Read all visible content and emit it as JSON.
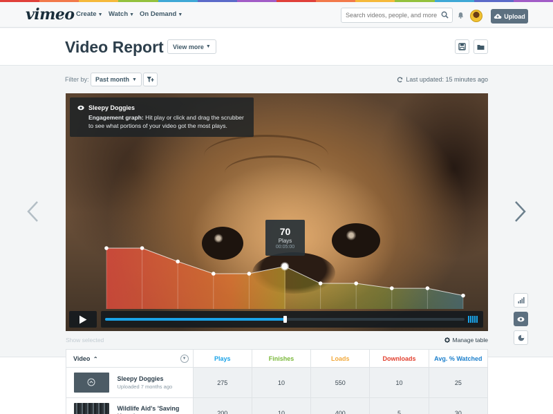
{
  "brand": {
    "logo": "vimeo",
    "accent": "#1aa3e8",
    "rainbow": [
      "#e0403a",
      "#f2794a",
      "#f5b93a",
      "#93c13d",
      "#3ea8d6",
      "#5b6ac9",
      "#a25cc7",
      "#e0403a",
      "#f2794a",
      "#f5b93a",
      "#93c13d",
      "#3ea8d6",
      "#5b6ac9",
      "#a25cc7"
    ]
  },
  "nav": {
    "items": [
      {
        "label": "Create"
      },
      {
        "label": "Watch"
      },
      {
        "label": "On Demand"
      }
    ],
    "search_placeholder": "Search videos, people, and more",
    "upload_label": "Upload"
  },
  "header": {
    "title": "Video Report",
    "view_more": "View more"
  },
  "filter": {
    "label": "Filter by:",
    "value": "Past month",
    "last_updated": "Last updated: 15 minutes ago"
  },
  "player": {
    "info_title": "Sleepy Doggies",
    "info_bold": "Engagement graph:",
    "info_text": " Hit play or click and drag the scrubber to see what portions of your video got the most plays.",
    "tooltip": {
      "value": "70",
      "label": "Plays",
      "time": "00:05:00"
    },
    "progress": 0.5,
    "engagement": [
      100,
      100,
      78,
      58,
      58,
      70,
      42,
      42,
      34,
      34,
      22
    ]
  },
  "below_player": {
    "show_selected": "Show selected",
    "manage_table": "Manage table"
  },
  "table": {
    "headers": [
      {
        "label": "Video",
        "color": "#2c3e4b"
      },
      {
        "label": "Plays",
        "color": "#1aa3e8"
      },
      {
        "label": "Finishes",
        "color": "#7ab83a"
      },
      {
        "label": "Loads",
        "color": "#f2a93b"
      },
      {
        "label": "Downloads",
        "color": "#e2402f"
      },
      {
        "label": "Avg. % Watched",
        "color": "#1b7fcc"
      }
    ],
    "rows": [
      {
        "title": "Sleepy Doggies",
        "subtitle": "Uploaded 7 months ago",
        "plays": "275",
        "finishes": "10",
        "loads": "550",
        "downloads": "10",
        "avg": "25"
      },
      {
        "title": "Wildlife Aid's 'Saving Harry'",
        "subtitle": "",
        "plays": "200",
        "finishes": "10",
        "loads": "400",
        "downloads": "5",
        "avg": "30"
      }
    ]
  }
}
